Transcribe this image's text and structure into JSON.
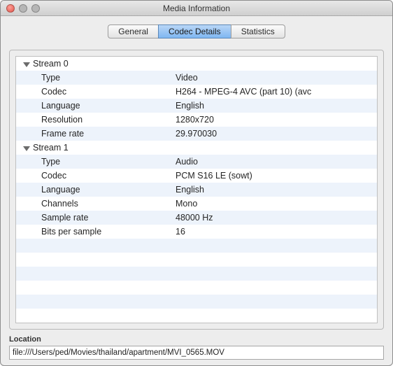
{
  "window": {
    "title": "Media Information"
  },
  "tabs": {
    "general": {
      "label": "General"
    },
    "codec": {
      "label": "Codec Details"
    },
    "stats": {
      "label": "Statistics"
    }
  },
  "streams": [
    {
      "header": "Stream 0",
      "rows": [
        {
          "key": "Type",
          "value": "Video"
        },
        {
          "key": "Codec",
          "value": "H264 - MPEG-4 AVC (part 10) (avc"
        },
        {
          "key": "Language",
          "value": "English"
        },
        {
          "key": "Resolution",
          "value": "1280x720"
        },
        {
          "key": "Frame rate",
          "value": "29.970030"
        }
      ]
    },
    {
      "header": "Stream 1",
      "rows": [
        {
          "key": "Type",
          "value": "Audio"
        },
        {
          "key": "Codec",
          "value": "PCM S16 LE (sowt)"
        },
        {
          "key": "Language",
          "value": "English"
        },
        {
          "key": "Channels",
          "value": "Mono"
        },
        {
          "key": "Sample rate",
          "value": "48000 Hz"
        },
        {
          "key": "Bits per sample",
          "value": "16"
        }
      ]
    }
  ],
  "location": {
    "label": "Location",
    "value": "file:///Users/ped/Movies/thailand/apartment/MVI_0565.MOV"
  }
}
